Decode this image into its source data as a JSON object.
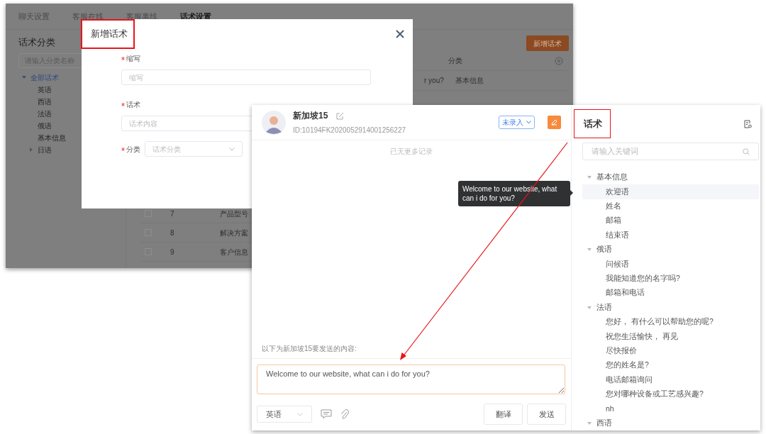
{
  "background_window": {
    "tabs": [
      {
        "label": "聊天设置",
        "selected": false
      },
      {
        "label": "客服在线",
        "selected": false
      },
      {
        "label": "客服离线",
        "selected": false
      },
      {
        "label": "话术设置",
        "selected": true
      }
    ],
    "sidebar": {
      "title": "话术分类",
      "search": {
        "placeholder": "请输入分类名称"
      },
      "tree": [
        {
          "label": "全部话术",
          "selected": true,
          "expanded": true,
          "children": [
            {
              "label": "英语",
              "selected": false
            },
            {
              "label": "西语",
              "selected": false
            },
            {
              "label": "法语",
              "selected": false
            },
            {
              "label": "俄语",
              "selected": false
            },
            {
              "label": "基本信息",
              "selected": false
            },
            {
              "label": "日语",
              "selected": false,
              "expanded": false
            }
          ]
        }
      ]
    },
    "add_button": "新增话术",
    "table": {
      "columns": [
        {
          "label": "分类"
        }
      ],
      "rows": [
        {
          "column_1": "r you?",
          "category": "基本信息"
        },
        {
          "checked": false,
          "number": "7",
          "category": "产品型号"
        },
        {
          "checked": false,
          "number": "8",
          "category": "解决方案"
        },
        {
          "checked": false,
          "number": "9",
          "category": "客户信息"
        }
      ]
    }
  },
  "dialog": {
    "title": "新增话术",
    "fields": [
      {
        "kind": "input",
        "label": "缩写",
        "required": true,
        "placeholder": "缩写"
      },
      {
        "kind": "input",
        "label": "话术",
        "required": true,
        "placeholder": "话术内容"
      },
      {
        "kind": "select",
        "label": "分类",
        "required": true,
        "placeholder": "话术分类"
      }
    ]
  },
  "chat": {
    "contact": {
      "name": "新加坡15",
      "id": "ID:10194FK2020052914001256227"
    },
    "status_select": "未录入",
    "no_more": "已无更多记录",
    "hint": "以下为新加坡15要发送的内容:",
    "message": "Welcome to our website, what can i do for you?",
    "language": "英语",
    "buttons": [
      "翻译",
      "发送"
    ]
  },
  "scripts": {
    "title": "话术",
    "search": {
      "placeholder": "请输入关键词"
    },
    "groups": [
      {
        "label": "基本信息",
        "expanded": true,
        "children": [
          {
            "label": "欢迎语",
            "selected": true
          },
          {
            "label": "姓名",
            "selected": false
          },
          {
            "label": "邮箱",
            "selected": false
          },
          {
            "label": "结束语",
            "selected": false
          }
        ]
      },
      {
        "label": "俄语",
        "expanded": true,
        "children": [
          {
            "label": "问候语",
            "selected": false
          },
          {
            "label": "我能知道您的名字吗?",
            "selected": false
          },
          {
            "label": "邮箱和电话",
            "selected": false
          }
        ]
      },
      {
        "label": "法语",
        "expanded": true,
        "children": [
          {
            "label": "您好， 有什么可以帮助您的呢?",
            "selected": false
          },
          {
            "label": "祝您生活愉快， 再见",
            "selected": false
          },
          {
            "label": "尽快报价",
            "selected": false
          },
          {
            "label": "您的姓名是?",
            "selected": false
          },
          {
            "label": "电话邮箱询问",
            "selected": false
          },
          {
            "label": "您对哪种设备或工艺感兴趣?",
            "selected": false
          },
          {
            "label": "nh",
            "selected": false
          }
        ]
      },
      {
        "label": "西语",
        "expanded": true
      }
    ]
  },
  "tooltip": "Welcome to our website, what can i do for you?"
}
